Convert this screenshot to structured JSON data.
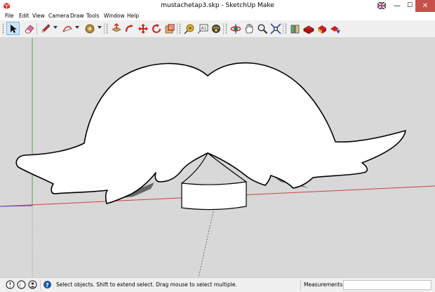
{
  "window": {
    "title": "mustachetap3.skp - SketchUp Make",
    "controls": {
      "minimize": "—",
      "maximize": "☐",
      "close": "✕"
    }
  },
  "menu": [
    "File",
    "Edit",
    "View",
    "Camera",
    "Draw",
    "Tools",
    "Window",
    "Help"
  ],
  "toolbar": {
    "tools": [
      {
        "name": "select-tool-button",
        "icon": "arrow-cursor-icon",
        "active": true
      },
      {
        "name": "eraser-tool-button",
        "icon": "eraser-icon"
      },
      {
        "name": "line-tool-button",
        "icon": "pencil-icon",
        "dropdown": true
      },
      {
        "name": "arc-tool-button",
        "icon": "arc-icon",
        "dropdown": true
      },
      {
        "name": "paint-bucket-button",
        "icon": "paint-bucket-icon",
        "dropdown": true
      },
      {
        "name": "push-pull-button",
        "icon": "push-pull-icon"
      },
      {
        "name": "follow-me-button",
        "icon": "follow-me-icon"
      },
      {
        "name": "move-tool-button",
        "icon": "move-arrows-icon"
      },
      {
        "name": "rotate-tool-button",
        "icon": "rotate-icon"
      },
      {
        "name": "scale-tool-button",
        "icon": "scale-icon"
      },
      {
        "name": "tape-measure-button",
        "icon": "tape-measure-icon"
      },
      {
        "name": "text-tool-button",
        "icon": "text-tool-icon"
      },
      {
        "name": "dimension-button",
        "icon": "dimension-icon"
      },
      {
        "name": "orbit-button",
        "icon": "orbit-icon"
      },
      {
        "name": "pan-button",
        "icon": "hand-icon"
      },
      {
        "name": "zoom-button",
        "icon": "magnifier-icon"
      },
      {
        "name": "zoom-extents-button",
        "icon": "zoom-extents-icon"
      },
      {
        "name": "warehouse-button",
        "icon": "warehouse-icon"
      },
      {
        "name": "components-button",
        "icon": "components-icon"
      },
      {
        "name": "extension-warehouse-button",
        "icon": "extension-icon"
      },
      {
        "name": "share-model-button",
        "icon": "share-icon"
      }
    ]
  },
  "status": {
    "hint": "Select objects. Shift to extend select. Drag mouse to select multiple.",
    "measurements_label": "Measurements",
    "measurements_value": ""
  },
  "colors": {
    "viewport_bg": "#d8d8d8",
    "red_axis": "#d04040",
    "green_axis": "#3fa83f",
    "blue_axis": "#4a4ad0",
    "close_button": "#c7504b"
  }
}
